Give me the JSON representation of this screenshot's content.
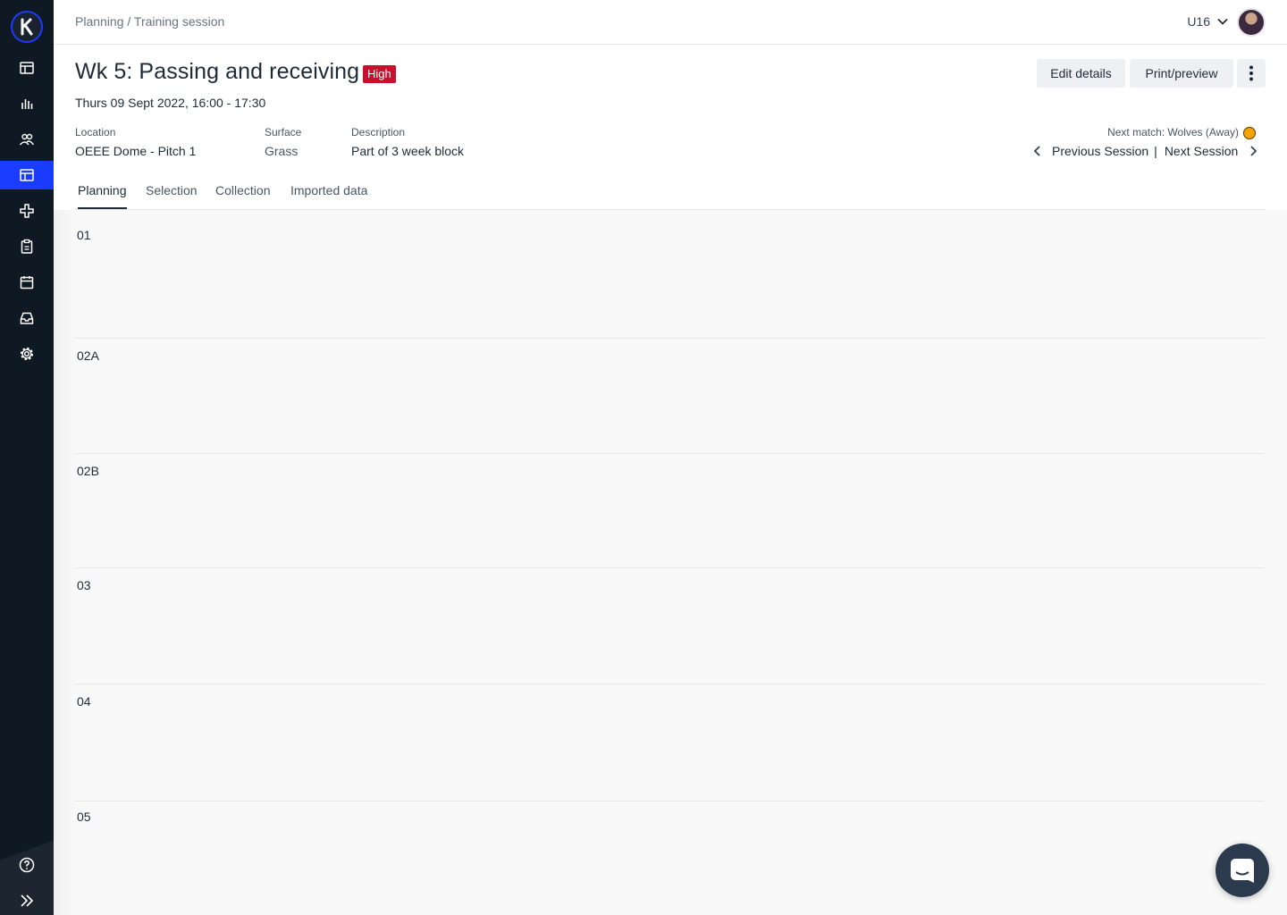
{
  "breadcrumb": "Planning / Training session",
  "team": "U16",
  "title": "Wk 5: Passing and receiving",
  "priority_badge": "High",
  "datetime": "Thurs 09 Sept 2022, 16:00 - 17:30",
  "actions": {
    "edit": "Edit details",
    "print": "Print/preview"
  },
  "meta": {
    "location_label": "Location",
    "location": "OEEE Dome - Pitch 1",
    "surface_label": "Surface",
    "surface": "Grass",
    "description_label": "Description",
    "description": "Part of 3 week block"
  },
  "next_match": "Next match: Wolves (Away)",
  "session_nav": {
    "previous": "Previous Session",
    "separator": "|",
    "next": "Next Session"
  },
  "tabs": [
    "Planning",
    "Selection",
    "Collection",
    "Imported data"
  ],
  "active_tab": "Planning",
  "sections": [
    "01",
    "02A",
    "02B",
    "03",
    "04",
    "05"
  ],
  "sidebar_icons": [
    "layout-icon",
    "analytics-icon",
    "athletes-icon",
    "planning-icon",
    "medical-icon",
    "forms-icon",
    "calendar-icon",
    "inbox-icon",
    "settings-icon",
    "help-icon",
    "expand-icon"
  ],
  "colors": {
    "sidebar": "#0f1923",
    "active_nav": "#1a3cff",
    "badge": "#c8102e"
  }
}
